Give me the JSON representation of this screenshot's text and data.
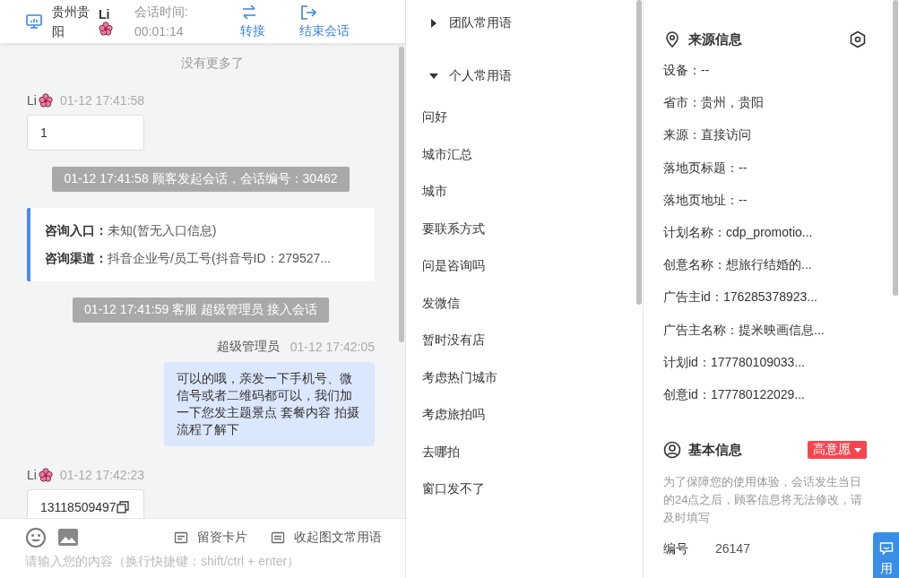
{
  "chat": {
    "header": {
      "location": "贵州贵阳",
      "visitor": "Li",
      "timer_label": "会话时间:",
      "timer": "00:01:14",
      "actions": [
        {
          "kind": "transfer",
          "label": "转接"
        },
        {
          "kind": "end",
          "label": "结束会话"
        }
      ]
    },
    "no_more": "没有更多了",
    "messages": [
      {
        "kind": "customer",
        "sender": "Li",
        "time": "01-12 17:41:58",
        "text": "1"
      },
      {
        "kind": "system",
        "text": "01-12 17:41:58 顾客发起会话，会话编号：30462"
      },
      {
        "kind": "entry",
        "rows": [
          {
            "label": "咨询入口：",
            "value": "未知(暂无入口信息)"
          },
          {
            "label": "咨询渠道：",
            "value": "抖音企业号/员工号(抖音号ID：279527..."
          }
        ]
      },
      {
        "kind": "system",
        "text": "01-12 17:41:59 客服 超级管理员 接入会话"
      },
      {
        "kind": "agent",
        "sender": "超级管理员",
        "time": "01-12 17:42:05",
        "text": "可以的哦，亲发一下手机号、微信号或者二维码都可以，我们加一下您发主题景点 套餐内容 拍摄流程了解下"
      },
      {
        "kind": "customer",
        "sender": "Li",
        "time": "01-12 17:42:23",
        "text": "13118509497",
        "copy": true
      }
    ],
    "tools": [
      {
        "kind": "card",
        "label": "留资卡片"
      },
      {
        "kind": "phrases",
        "label": "收起图文常用语"
      }
    ],
    "input": {
      "placeholder": "请输入您的内容（换行快捷键：shift/ctrl + enter）"
    }
  },
  "phrases": {
    "groups": [
      {
        "title": "团队常用语",
        "expanded": false
      },
      {
        "title": "个人常用语",
        "expanded": true,
        "items": [
          "问好",
          "城市汇总",
          "城市",
          "要联系方式",
          "问是咨询吗",
          "发微信",
          "暂时没有店",
          "考虑热门城市",
          "考虑旅拍吗",
          "去哪拍",
          "窗口发不了"
        ]
      }
    ]
  },
  "info": {
    "source": {
      "title": "来源信息",
      "rows": [
        "设备：--",
        "省市：贵州，贵阳",
        "来源：直接访问",
        "落地页标题：--",
        "落地页地址：--",
        "计划名称：cdp_promotio...",
        "创意名称：想旅行结婚的...",
        "广告主id：176285378923...",
        "广告主名称：提米映画信息...",
        "计划id：177780109033...",
        "创意id：177780122029..."
      ]
    },
    "basic": {
      "title": "基本信息",
      "tag": "高意愿",
      "note": "为了保障您的使用体验，会话发生当日的24点之后，顾客信息将无法修改，请及时填写",
      "fields": [
        {
          "label": "编号",
          "value": "26147"
        }
      ]
    }
  },
  "float_tab": {
    "label": "用"
  }
}
